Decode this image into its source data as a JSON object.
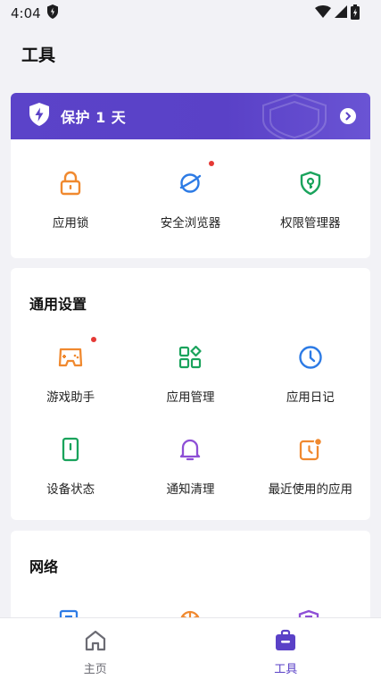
{
  "status": {
    "time": "4:04"
  },
  "page": {
    "title": "工具"
  },
  "banner": {
    "title": "保护 1 天"
  },
  "top_tools": [
    {
      "label": "应用锁",
      "icon": "lock-icon",
      "color": "#f0892f",
      "badge": false
    },
    {
      "label": "安全浏览器",
      "icon": "planet-icon",
      "color": "#2d7be5",
      "badge": true
    },
    {
      "label": "权限管理器",
      "icon": "shield-key-icon",
      "color": "#1aa35c",
      "badge": false
    }
  ],
  "general": {
    "title": "通用设置",
    "items": [
      {
        "label": "游戏助手",
        "icon": "gamepad-icon",
        "color": "#f0892f",
        "badge": true
      },
      {
        "label": "应用管理",
        "icon": "apps-grid-icon",
        "color": "#1aa35c",
        "badge": false
      },
      {
        "label": "应用日记",
        "icon": "clock-icon",
        "color": "#2d7be5",
        "badge": false
      },
      {
        "label": "设备状态",
        "icon": "phone-icon",
        "color": "#1aa35c",
        "badge": false
      },
      {
        "label": "通知清理",
        "icon": "bell-icon",
        "color": "#8e4fd6",
        "badge": false
      },
      {
        "label": "最近使用的应用",
        "icon": "recent-apps-icon",
        "color": "#f0892f",
        "badge": false
      }
    ]
  },
  "network": {
    "title": "网络"
  },
  "bottom_nav": [
    {
      "label": "主页",
      "icon": "home-icon",
      "active": false
    },
    {
      "label": "工具",
      "icon": "toolbox-icon",
      "active": true
    }
  ],
  "colors": {
    "accent": "#5a41c7",
    "badge": "#e53935"
  }
}
